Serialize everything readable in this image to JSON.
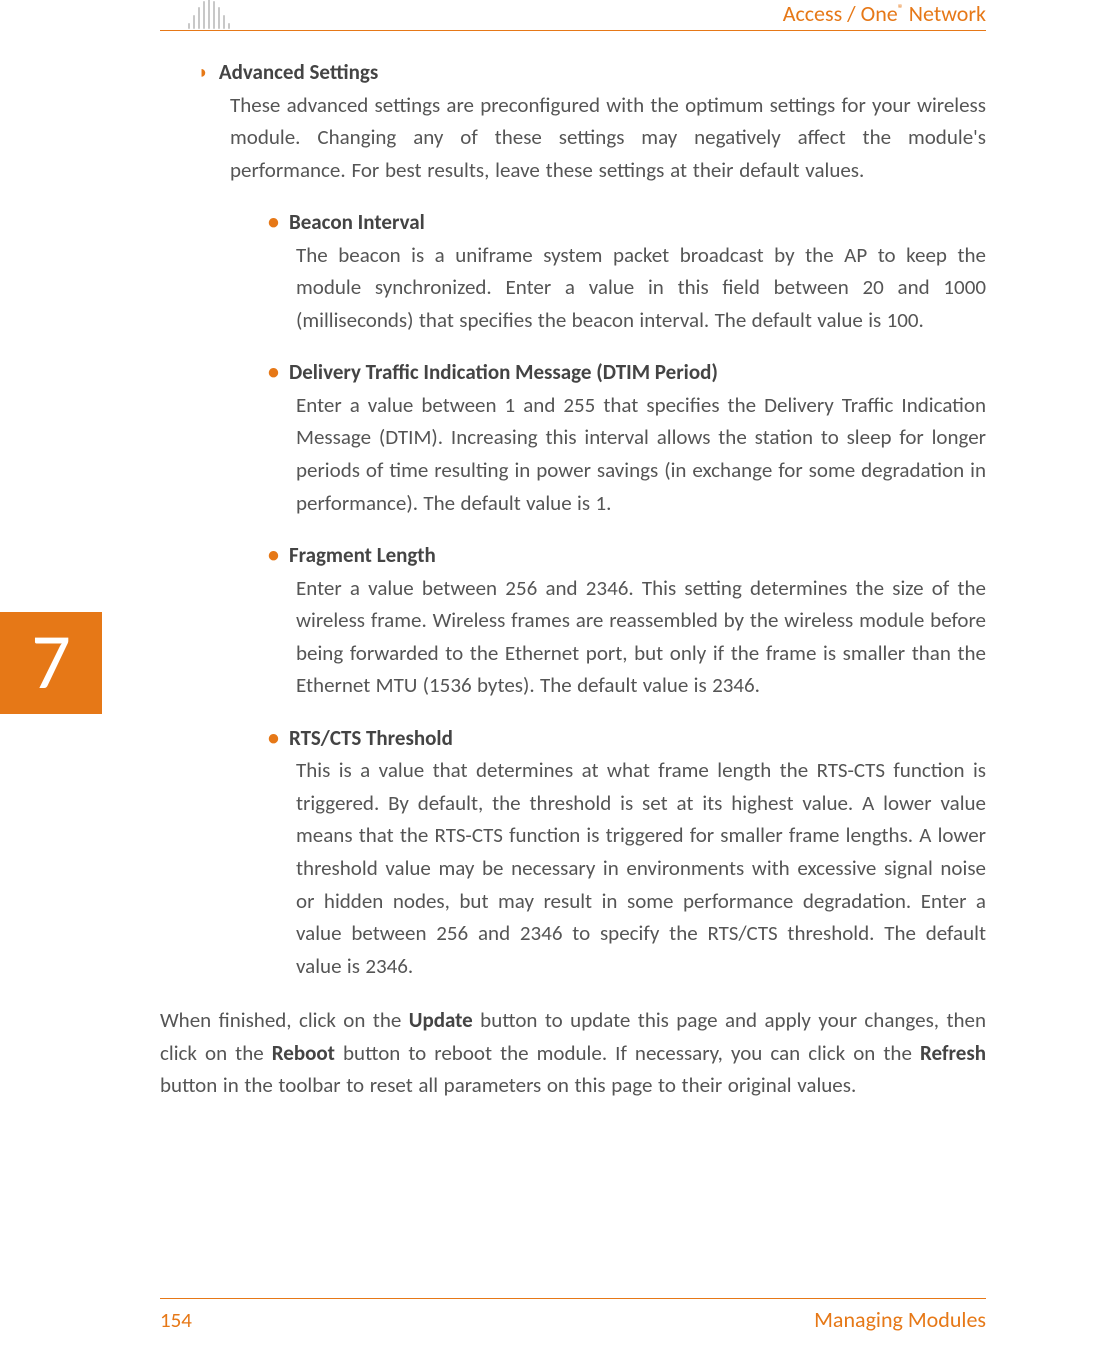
{
  "header": {
    "brand_prefix": "Access / One",
    "brand_reg": "®",
    "brand_suffix": " Network"
  },
  "chapter_number": "7",
  "section": {
    "title": "Advanced Settings",
    "intro": "These advanced settings are preconfigured with the optimum settings for your wireless module. Changing any of these settings may negatively affect the module's performance. For best results, leave these settings at their default values.",
    "items": [
      {
        "title": "Beacon Interval",
        "body": "The beacon is a uniframe system packet broadcast by the AP to keep the module synchronized. Enter a value in this field between 20 and 1000 (milliseconds) that specifies the beacon interval. The default value is 100."
      },
      {
        "title": "Delivery Traffic Indication Message (DTIM Period)",
        "body": "Enter a value between 1 and 255 that specifies the Delivery Traffic Indication Message (DTIM). Increasing this interval allows the station to sleep for longer periods of time resulting in power savings (in exchange for some degradation in performance). The default value is 1."
      },
      {
        "title": "Fragment Length",
        "body": "Enter a value between 256 and 2346. This setting determines the size of the wireless frame. Wireless frames are reassembled by the wireless module before being forwarded to the Ethernet port, but only if the frame is smaller than the Ethernet MTU (1536 bytes). The default value is 2346."
      },
      {
        "title": "RTS/CTS Threshold",
        "body": "This is a value that determines at what frame length the RTS-CTS function is triggered. By default, the threshold is set at its highest value. A lower value means that the RTS-CTS function is triggered for smaller frame lengths. A lower threshold value may be necessary in environments with excessive signal noise or hidden nodes, but may result in some performance degradation. Enter a value between 256 and 2346 to specify the RTS/CTS threshold. The default value is 2346."
      }
    ]
  },
  "closing": {
    "p1a": "When finished, click on the ",
    "b1": "Update",
    "p1b": " button to update this page and apply your changes, then click on the ",
    "b2": "Reboot",
    "p1c": " button to reboot the module. If necessary, you can click on the ",
    "b3": "Refresh",
    "p1d": " button in the toolbar to reset all parameters on this page to their original values."
  },
  "footer": {
    "page": "154",
    "title": "Managing Modules"
  }
}
